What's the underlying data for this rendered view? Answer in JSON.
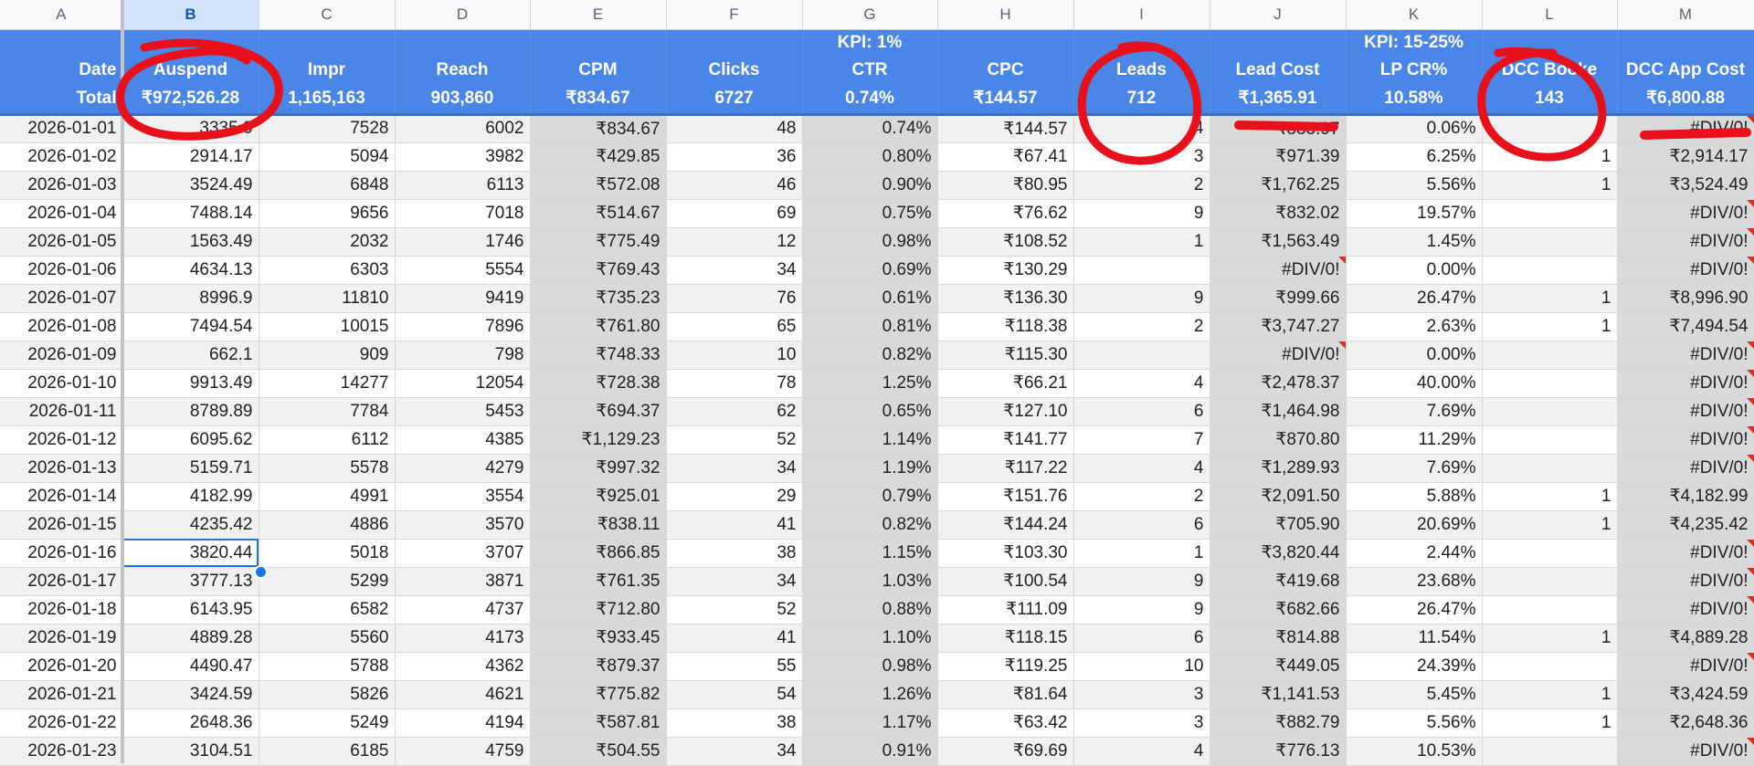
{
  "column_letters": [
    "A",
    "B",
    "C",
    "D",
    "E",
    "F",
    "G",
    "H",
    "I",
    "J",
    "K",
    "L",
    "M"
  ],
  "active_column": "B",
  "kpi_row": [
    "",
    "",
    "",
    "",
    "",
    "",
    "KPI: 1%",
    "",
    "",
    "",
    "KPI: 15-25%",
    "",
    ""
  ],
  "headers": [
    "Date",
    "Auspend",
    "Impr",
    "Reach",
    "CPM",
    "Clicks",
    "CTR",
    "CPC",
    "Leads",
    "Lead Cost",
    "LP CR%",
    "DCC Booke",
    "DCC App Cost"
  ],
  "totals": [
    "Total",
    "₹972,526.28",
    "1,165,163",
    "903,860",
    "₹834.67",
    "6727",
    "0.74%",
    "₹144.57",
    "712",
    "₹1,365.91",
    "10.58%",
    "143",
    "₹6,800.88"
  ],
  "rows": [
    [
      "2026-01-01",
      "3335.0",
      "7528",
      "6002",
      "₹834.67",
      "48",
      "0.74%",
      "₹144.57",
      "4",
      "₹833.97",
      "0.06%",
      "",
      "#DIV/0!"
    ],
    [
      "2026-01-02",
      "2914.17",
      "5094",
      "3982",
      "₹429.85",
      "36",
      "0.80%",
      "₹67.41",
      "3",
      "₹971.39",
      "6.25%",
      "1",
      "₹2,914.17"
    ],
    [
      "2026-01-03",
      "3524.49",
      "6848",
      "6113",
      "₹572.08",
      "46",
      "0.90%",
      "₹80.95",
      "2",
      "₹1,762.25",
      "5.56%",
      "1",
      "₹3,524.49"
    ],
    [
      "2026-01-04",
      "7488.14",
      "9656",
      "7018",
      "₹514.67",
      "69",
      "0.75%",
      "₹76.62",
      "9",
      "₹832.02",
      "19.57%",
      "",
      "#DIV/0!"
    ],
    [
      "2026-01-05",
      "1563.49",
      "2032",
      "1746",
      "₹775.49",
      "12",
      "0.98%",
      "₹108.52",
      "1",
      "₹1,563.49",
      "1.45%",
      "",
      "#DIV/0!"
    ],
    [
      "2026-01-06",
      "4634.13",
      "6303",
      "5554",
      "₹769.43",
      "34",
      "0.69%",
      "₹130.29",
      "",
      "#DIV/0!",
      "0.00%",
      "",
      "#DIV/0!"
    ],
    [
      "2026-01-07",
      "8996.9",
      "11810",
      "9419",
      "₹735.23",
      "76",
      "0.61%",
      "₹136.30",
      "9",
      "₹999.66",
      "26.47%",
      "1",
      "₹8,996.90"
    ],
    [
      "2026-01-08",
      "7494.54",
      "10015",
      "7896",
      "₹761.80",
      "65",
      "0.81%",
      "₹118.38",
      "2",
      "₹3,747.27",
      "2.63%",
      "1",
      "₹7,494.54"
    ],
    [
      "2026-01-09",
      "662.1",
      "909",
      "798",
      "₹748.33",
      "10",
      "0.82%",
      "₹115.30",
      "",
      "#DIV/0!",
      "0.00%",
      "",
      "#DIV/0!"
    ],
    [
      "2026-01-10",
      "9913.49",
      "14277",
      "12054",
      "₹728.38",
      "78",
      "1.25%",
      "₹66.21",
      "4",
      "₹2,478.37",
      "40.00%",
      "",
      "#DIV/0!"
    ],
    [
      "2026-01-11",
      "8789.89",
      "7784",
      "5453",
      "₹694.37",
      "62",
      "0.65%",
      "₹127.10",
      "6",
      "₹1,464.98",
      "7.69%",
      "",
      "#DIV/0!"
    ],
    [
      "2026-01-12",
      "6095.62",
      "6112",
      "4385",
      "₹1,129.23",
      "52",
      "1.14%",
      "₹141.77",
      "7",
      "₹870.80",
      "11.29%",
      "",
      "#DIV/0!"
    ],
    [
      "2026-01-13",
      "5159.71",
      "5578",
      "4279",
      "₹997.32",
      "34",
      "1.19%",
      "₹117.22",
      "4",
      "₹1,289.93",
      "7.69%",
      "",
      "#DIV/0!"
    ],
    [
      "2026-01-14",
      "4182.99",
      "4991",
      "3554",
      "₹925.01",
      "29",
      "0.79%",
      "₹151.76",
      "2",
      "₹2,091.50",
      "5.88%",
      "1",
      "₹4,182.99"
    ],
    [
      "2026-01-15",
      "4235.42",
      "4886",
      "3570",
      "₹838.11",
      "41",
      "0.82%",
      "₹144.24",
      "6",
      "₹705.90",
      "20.69%",
      "1",
      "₹4,235.42"
    ],
    [
      "2026-01-16",
      "3820.44",
      "5018",
      "3707",
      "₹866.85",
      "38",
      "1.15%",
      "₹103.30",
      "1",
      "₹3,820.44",
      "2.44%",
      "",
      "#DIV/0!"
    ],
    [
      "2026-01-17",
      "3777.13",
      "5299",
      "3871",
      "₹761.35",
      "34",
      "1.03%",
      "₹100.54",
      "9",
      "₹419.68",
      "23.68%",
      "",
      "#DIV/0!"
    ],
    [
      "2026-01-18",
      "6143.95",
      "6582",
      "4737",
      "₹712.80",
      "52",
      "0.88%",
      "₹111.09",
      "9",
      "₹682.66",
      "26.47%",
      "",
      "#DIV/0!"
    ],
    [
      "2026-01-19",
      "4889.28",
      "5560",
      "4173",
      "₹933.45",
      "41",
      "1.10%",
      "₹118.15",
      "6",
      "₹814.88",
      "11.54%",
      "1",
      "₹4,889.28"
    ],
    [
      "2026-01-20",
      "4490.47",
      "5788",
      "4362",
      "₹879.37",
      "55",
      "0.98%",
      "₹119.25",
      "10",
      "₹449.05",
      "24.39%",
      "",
      "#DIV/0!"
    ],
    [
      "2026-01-21",
      "3424.59",
      "5826",
      "4621",
      "₹775.82",
      "54",
      "1.26%",
      "₹81.64",
      "3",
      "₹1,141.53",
      "5.45%",
      "1",
      "₹3,424.59"
    ],
    [
      "2026-01-22",
      "2648.36",
      "5249",
      "4194",
      "₹587.81",
      "38",
      "1.17%",
      "₹63.42",
      "3",
      "₹882.79",
      "5.56%",
      "1",
      "₹2,648.36"
    ],
    [
      "2026-01-23",
      "3104.51",
      "6185",
      "4759",
      "₹504.55",
      "34",
      "0.91%",
      "₹69.69",
      "4",
      "₹776.13",
      "10.53%",
      "",
      "#DIV/0!"
    ]
  ],
  "selected_cell": "B16",
  "annotation_color": "#e8101a"
}
